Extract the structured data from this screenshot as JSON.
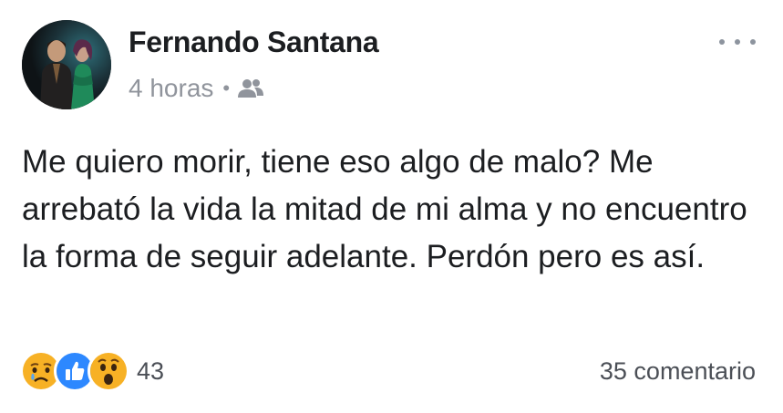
{
  "post": {
    "author": "Fernando Santana",
    "time": "4 horas",
    "separator": "•",
    "audience_icon": "friends-icon",
    "text": "Me quiero morir, tiene eso algo de malo? Me arrebató la vida la mitad de mi alma y no encuentro la forma de seguir adelante. Perdón pero es así.",
    "reactions": {
      "icons": [
        "sad-reaction-icon",
        "like-reaction-icon",
        "wow-reaction-icon"
      ],
      "count": "43"
    },
    "comments": "35 comentario"
  },
  "colors": {
    "text": "#1c1e21",
    "meta": "#90949c",
    "like_blue": "#2d88ff",
    "emoji_yellow": "#f7b125"
  }
}
